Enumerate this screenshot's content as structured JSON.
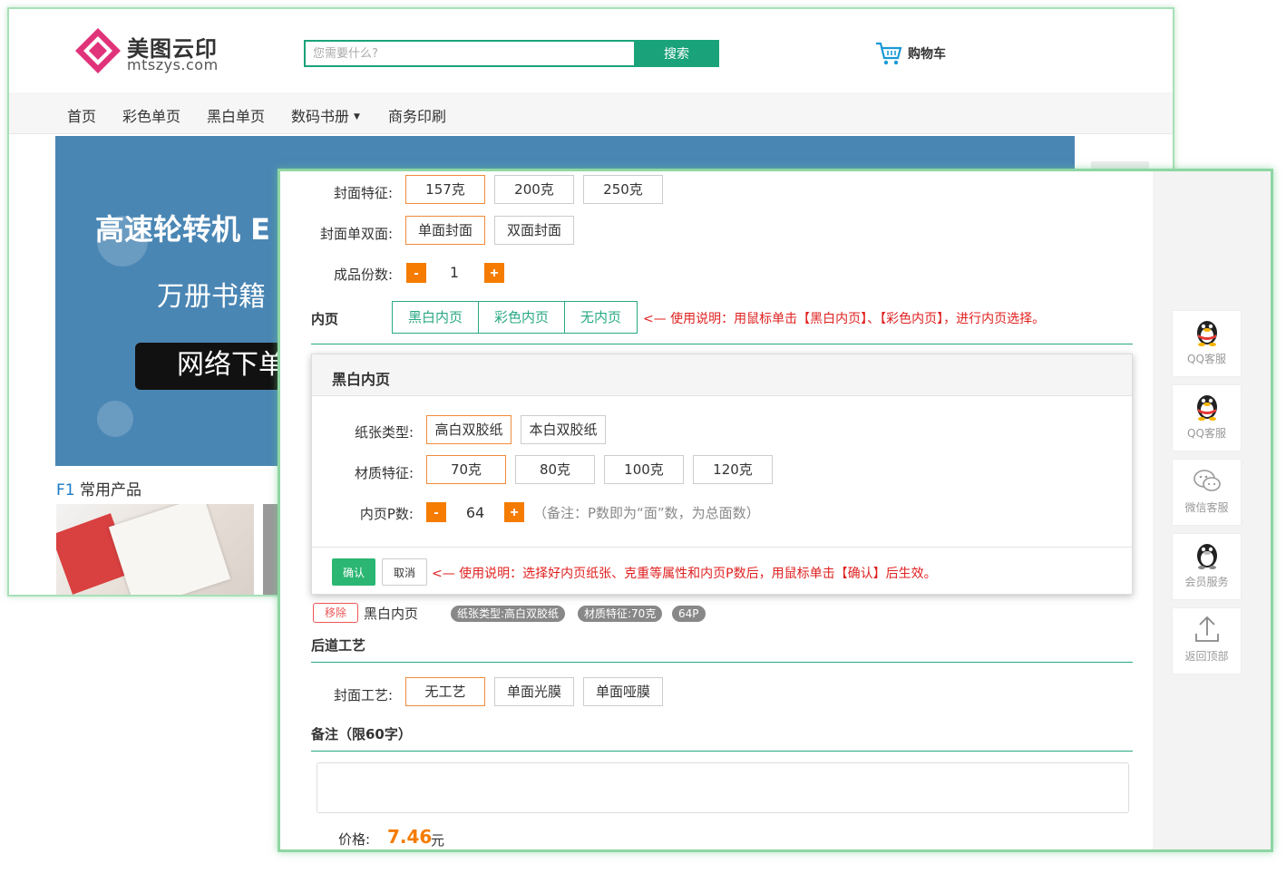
{
  "site": {
    "logo_title": "美图云印",
    "logo_sub": "mtszys.com",
    "search_placeholder": "您需要什么?",
    "search_button": "搜索",
    "cart_label": "购物车"
  },
  "nav": [
    "首页",
    "彩色单页",
    "黑白单页",
    "数码书册",
    "商务印刷"
  ],
  "banner": {
    "title": "高速轮转机 E",
    "subtitle": "万册书籍",
    "pill": "网络下单"
  },
  "section_f1": {
    "prefix": "F1",
    "label": "常用产品"
  },
  "form": {
    "cover_weight": {
      "label": "封面特征:",
      "options": [
        "157克",
        "200克",
        "250克"
      ],
      "selected": "157克"
    },
    "cover_sides": {
      "label": "封面单双面:",
      "options": [
        "单面封面",
        "双面封面"
      ],
      "selected": "单面封面"
    },
    "copies": {
      "label": "成品份数:",
      "value": "1",
      "minus": "-",
      "plus": "+"
    },
    "inner": {
      "title": "内页",
      "tabs": [
        "黑白内页",
        "彩色内页",
        "无内页"
      ],
      "note": "<— 使用说明：用鼠标单击【黑白内页】、【彩色内页】，进行内页选择。"
    },
    "modal": {
      "title": "黑白内页",
      "paper": {
        "label": "纸张类型:",
        "options": [
          "高白双胶纸",
          "本白双胶纸"
        ],
        "selected": "高白双胶纸"
      },
      "material": {
        "label": "材质特征:",
        "options": [
          "70克",
          "80克",
          "100克",
          "120克"
        ],
        "selected": "70克"
      },
      "pages": {
        "label": "内页P数:",
        "value": "64",
        "minus": "-",
        "plus": "+",
        "note": "（备注：P数即为“面”数，为总面数）"
      },
      "ok": "确认",
      "cancel": "取消",
      "note": "<— 使用说明：选择好内页纸张、克重等属性和内页P数后，用鼠标单击【确认】后生效。"
    },
    "selection": {
      "remove": "移除",
      "name": "黑白内页",
      "chips": [
        "纸张类型:高白双胶纸",
        "材质特征:70克",
        "64P"
      ]
    },
    "finishing": {
      "title": "后道工艺",
      "label": "封面工艺:",
      "options": [
        "无工艺",
        "单面光膜",
        "单面哑膜"
      ],
      "selected": "无工艺"
    },
    "remark": {
      "title": "备注（限60字）",
      "value": ""
    },
    "price": {
      "label": "价格:",
      "value": "7.46",
      "unit": "元"
    }
  },
  "sidebar": [
    {
      "label": "QQ客服",
      "icon": "qq-penguin-icon"
    },
    {
      "label": "QQ客服",
      "icon": "qq-penguin-icon"
    },
    {
      "label": "微信客服",
      "icon": "wechat-icon"
    },
    {
      "label": "会员服务",
      "icon": "member-icon"
    },
    {
      "label": "返回顶部",
      "icon": "back-to-top-icon"
    }
  ],
  "colors": {
    "accent": "#1aa37a",
    "orange": "#f57c00",
    "red": "#e02020",
    "banner": "#4a86b4"
  }
}
